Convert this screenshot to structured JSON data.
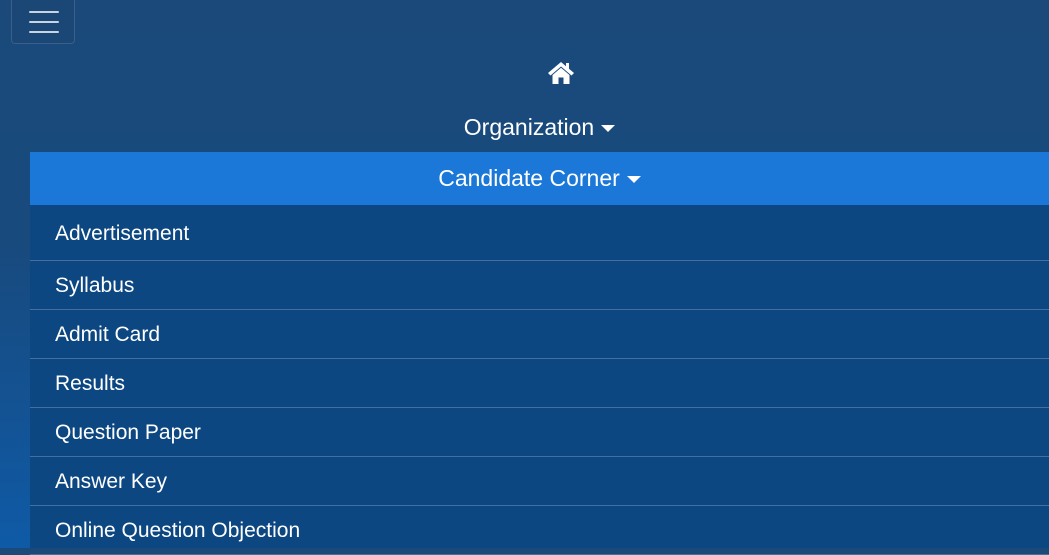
{
  "header": {
    "menu_toggle_icon": "hamburger-icon",
    "home_icon": "home-icon"
  },
  "nav": {
    "organization_label": "Organization",
    "candidate_corner_label": "Candidate Corner"
  },
  "candidate_corner_menu": {
    "items": [
      {
        "label": "Advertisement"
      },
      {
        "label": "Syllabus"
      },
      {
        "label": "Admit Card"
      },
      {
        "label": "Results"
      },
      {
        "label": "Question Paper"
      },
      {
        "label": "Answer Key"
      },
      {
        "label": "Online Question Objection"
      }
    ]
  },
  "colors": {
    "background": "#184a7e",
    "active_nav": "#1b78d8",
    "dropdown_bg": "#0d4781",
    "divider": "#456f9d",
    "text": "#ffffff"
  }
}
